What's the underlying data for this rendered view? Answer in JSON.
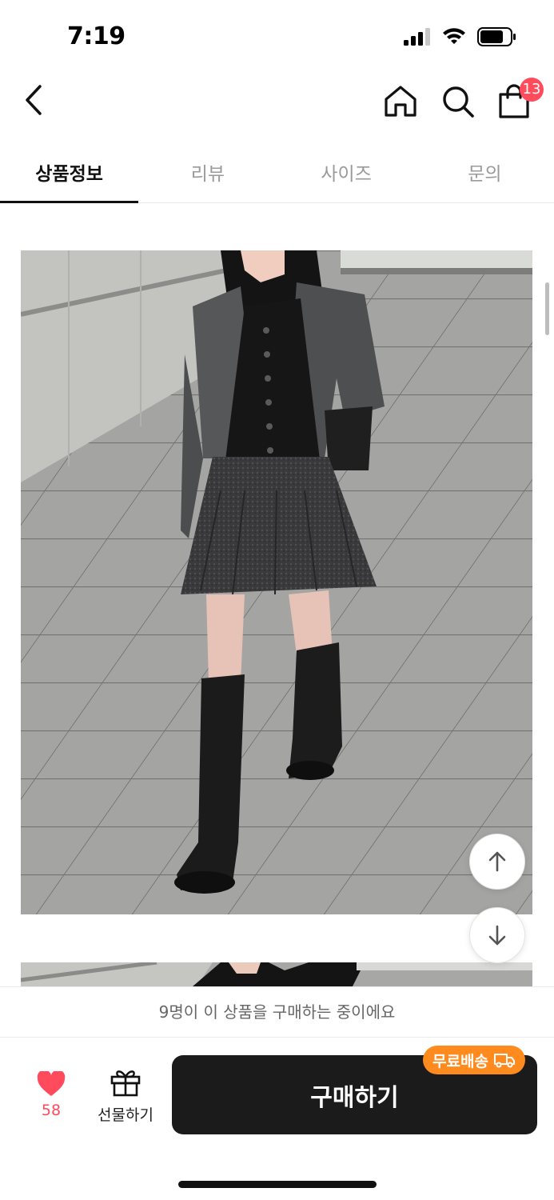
{
  "status_bar": {
    "time": "7:19"
  },
  "header": {
    "icons": {
      "back": "chevron-left-icon",
      "home": "home-icon",
      "search": "search-icon",
      "cart": "shopping-bag-icon"
    },
    "cart_badge": "13"
  },
  "tabs": [
    {
      "label": "상품정보",
      "active": true
    },
    {
      "label": "리뷰",
      "active": false
    },
    {
      "label": "사이즈",
      "active": false
    },
    {
      "label": "문의",
      "active": false
    }
  ],
  "notice": "9명이 이 상품을 구매하는 중이에요",
  "bottom_bar": {
    "like_count": "58",
    "gift_label": "선물하기",
    "buy_label": "구매하기",
    "shipping_badge": "무료배송"
  },
  "colors": {
    "accent_red": "#ff4b5c",
    "badge_orange": "#ff8a1d",
    "buy_button": "#1b1b1b"
  }
}
